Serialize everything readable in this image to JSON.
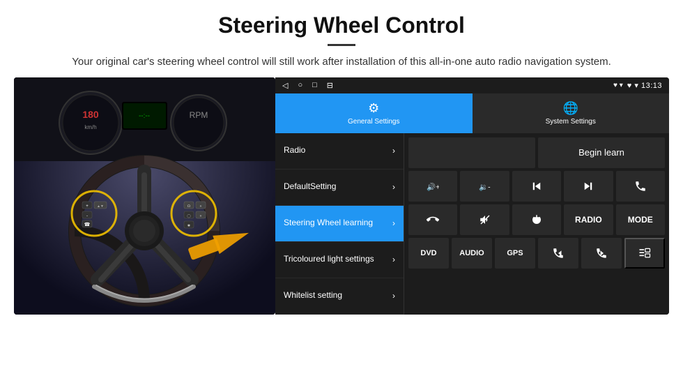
{
  "header": {
    "title": "Steering Wheel Control",
    "subtitle": "Your original car's steering wheel control will still work after installation of this all-in-one auto radio navigation system."
  },
  "status_bar": {
    "left_icons": [
      "◁",
      "○",
      "□",
      "⊟"
    ],
    "right_text": "♥ ▾ 13:13"
  },
  "tabs": [
    {
      "label": "General Settings",
      "active": true,
      "icon": "⚙"
    },
    {
      "label": "System Settings",
      "active": false,
      "icon": "🌐"
    }
  ],
  "menu_items": [
    {
      "label": "Radio",
      "active": false
    },
    {
      "label": "DefaultSetting",
      "active": false
    },
    {
      "label": "Steering Wheel learning",
      "active": true
    },
    {
      "label": "Tricoloured light settings",
      "active": false
    },
    {
      "label": "Whitelist setting",
      "active": false
    }
  ],
  "controls": {
    "begin_learn": "Begin learn",
    "row2": [
      "vol+",
      "vol-",
      "prev",
      "next",
      "phone"
    ],
    "row3": [
      "hang",
      "mute",
      "power",
      "RADIO",
      "MODE"
    ],
    "row4": [
      "DVD",
      "AUDIO",
      "GPS",
      "tel+prev",
      "tel+next"
    ],
    "row4_icon": "list"
  },
  "colors": {
    "active_blue": "#2196F3",
    "dark_bg": "#1c1c1c",
    "cell_bg": "#2a2a2a",
    "text_white": "#ffffff"
  }
}
